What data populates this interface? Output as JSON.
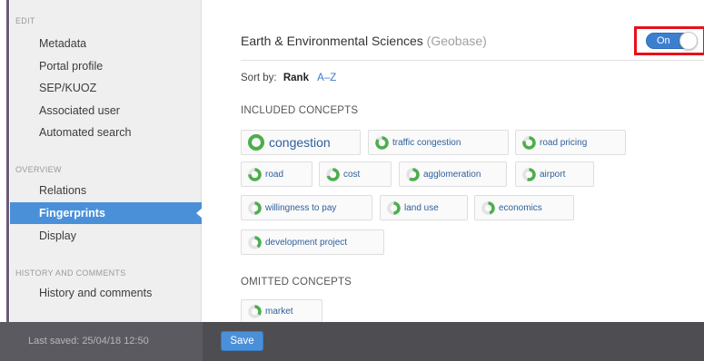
{
  "sidebar": {
    "sections": [
      {
        "title": "EDIT",
        "items": [
          "Metadata",
          "Portal profile",
          "SEP/KUOZ",
          "Associated user",
          "Automated search"
        ]
      },
      {
        "title": "OVERVIEW",
        "items": [
          "Relations",
          "Fingerprints",
          "Display"
        ]
      },
      {
        "title": "HISTORY AND COMMENTS",
        "items": [
          "History and comments"
        ]
      }
    ],
    "active_item": "Fingerprints"
  },
  "main": {
    "title": "Earth & Environmental Sciences",
    "source": "(Geobase)",
    "toggle_label": "On",
    "sort_label": "Sort by:",
    "sort_selected": "Rank",
    "sort_alternative": "A–Z",
    "included_title": "INCLUDED CONCEPTS",
    "included": [
      {
        "label": "congestion",
        "weight": 1.0
      },
      {
        "label": "traffic congestion",
        "weight": 0.85
      },
      {
        "label": "road pricing",
        "weight": 0.8
      },
      {
        "label": "road",
        "weight": 0.75
      },
      {
        "label": "cost",
        "weight": 0.7
      },
      {
        "label": "agglomeration",
        "weight": 0.6
      },
      {
        "label": "airport",
        "weight": 0.55
      },
      {
        "label": "willingness to pay",
        "weight": 0.5
      },
      {
        "label": "land use",
        "weight": 0.5
      },
      {
        "label": "economics",
        "weight": 0.45
      },
      {
        "label": "development project",
        "weight": 0.4
      }
    ],
    "omitted_title": "OMITTED CONCEPTS",
    "omitted": [
      {
        "label": "market",
        "weight": 0.35
      }
    ]
  },
  "footer": {
    "last_saved": "Last saved: 25/04/18 12:50",
    "save_label": "Save"
  },
  "colors": {
    "accent": "#4a90d9",
    "donut": "#4cae4c",
    "highlight_frame": "#e8101a"
  }
}
